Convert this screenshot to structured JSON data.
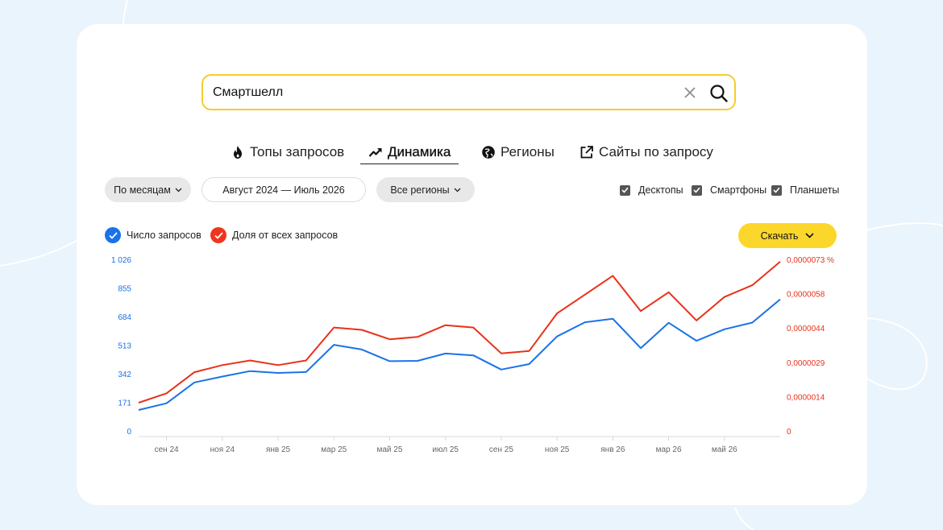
{
  "search": {
    "value": "Смартшелл"
  },
  "tabs": [
    {
      "label": "Топы запросов",
      "icon": "fire-icon"
    },
    {
      "label": "Динамика",
      "icon": "trend-up-icon",
      "active": true
    },
    {
      "label": "Регионы",
      "icon": "globe-icon"
    },
    {
      "label": "Сайты по запросу",
      "icon": "external-link-icon"
    }
  ],
  "filters": {
    "period_label": "По месяцам",
    "date_range": "Август 2024 — Июль 2026",
    "region_label": "Все регионы"
  },
  "devices": [
    {
      "label": "Десктопы",
      "checked": true
    },
    {
      "label": "Смартфоны",
      "checked": true
    },
    {
      "label": "Планшеты",
      "checked": true
    }
  ],
  "legend": [
    {
      "label": "Число запросов",
      "color": "#1a73e8",
      "checked": true
    },
    {
      "label": "Доля от всех запросов",
      "color": "#f0351f",
      "checked": true
    }
  ],
  "download_label": "Скачать",
  "colors": {
    "accent_yellow": "#fcd72b",
    "search_border": "#f5cd2d",
    "blue": "#1a73e8",
    "red": "#e8321a"
  },
  "chart_data": {
    "type": "line",
    "x_tick_labels": [
      "сен 24",
      "ноя 24",
      "янв 25",
      "мар 25",
      "май 25",
      "июл 25",
      "сен 25",
      "ноя 25",
      "янв 26",
      "мар 26",
      "май 26"
    ],
    "y_left_ticks": [
      "0",
      "171",
      "342",
      "513",
      "684",
      "855",
      "1 026"
    ],
    "y_right_ticks": [
      "0",
      "0,0000014",
      "0,0000029",
      "0,0000044",
      "0,0000058",
      "0,0000073 %"
    ],
    "y_left_range": [
      0,
      1026
    ],
    "y_right_range": [
      0,
      7.3e-06
    ],
    "series": [
      {
        "name": "Число запросов",
        "axis": "left",
        "color": "#1a73e8",
        "values": [
          125,
          165,
          290,
          325,
          358,
          347,
          352,
          515,
          487,
          417,
          419,
          463,
          452,
          367,
          400,
          565,
          650,
          671,
          495,
          647,
          539,
          608,
          648,
          787
        ]
      },
      {
        "name": "Доля от всех запросов",
        "axis": "right",
        "color": "#e8321a",
        "values": [
          1.2e-06,
          1.6e-06,
          2.5e-06,
          2.8e-06,
          3e-06,
          2.8e-06,
          3e-06,
          4.4e-06,
          4.3e-06,
          3.9e-06,
          4e-06,
          4.5e-06,
          4.4e-06,
          3.3e-06,
          3.4e-06,
          5e-06,
          5.8e-06,
          6.6e-06,
          5.1e-06,
          5.9e-06,
          4.7e-06,
          5.7e-06,
          6.2e-06,
          7.2e-06
        ]
      }
    ]
  }
}
